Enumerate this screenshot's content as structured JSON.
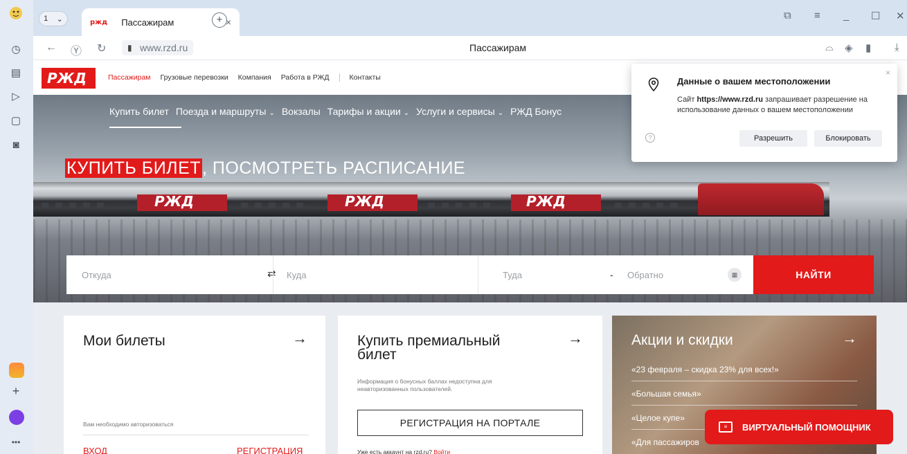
{
  "browser": {
    "tab_count": "1",
    "tab_favicon": "ржд",
    "tab_title": "Пассажирам",
    "tab_close": "×",
    "new_tab": "+",
    "url": "www.rzd.ru",
    "page_title": "Пассажирам"
  },
  "rzd": {
    "logo": "РЖД",
    "top_links": [
      "Пассажирам",
      "Грузовые перевозки",
      "Компания",
      "Работа в РЖД",
      "Контакты"
    ],
    "hero_menu": [
      "Купить билет",
      "Поезда и маршруты",
      "Вокзалы",
      "Тарифы и акции",
      "Услуги и сервисы",
      "РЖД Бонус"
    ],
    "headline_red": "КУПИТЬ БИЛЕТ",
    "headline_rest": ", ПОСМОТРЕТЬ РАСПИСАНИЕ",
    "search": {
      "from_placeholder": "Откуда",
      "to_placeholder": "Куда",
      "there_placeholder": "Туда",
      "back_placeholder": "Обратно",
      "swap": "⇄",
      "dash": "-",
      "find_label": "НАЙТИ"
    },
    "my_tickets": {
      "title": "Мои билеты",
      "need_auth": "Вам необходимо авторизоваться",
      "login": "ВХОД",
      "register": "РЕГИСТРАЦИЯ"
    },
    "premium": {
      "title_line1": "Купить премиальный",
      "title_line2": "билет",
      "info_line1": "Информация о бонусных баллах недоступна для",
      "info_line2": "неавторизованных пользователей.",
      "register_portal": "РЕГИСТРАЦИЯ НА ПОРТАЛЕ",
      "have_account": "Уже есть аккаунт на rzd.ru?",
      "login_link": "Войти"
    },
    "promo": {
      "title": "Акции и скидки",
      "items": [
        "«23 февраля – скидка 23% для всех!»",
        "«Большая семья»",
        "«Целое купе»",
        "«Для пассажиров"
      ]
    },
    "assistant": "ВИРТУАЛЬНЫЙ ПОМОЩНИК"
  },
  "location_popup": {
    "title": "Данные о вашем местоположении",
    "site_prefix": "Сайт",
    "site": "https://www.rzd.ru",
    "body": "запрашивает разрешение на использование данных о вашем местоположении",
    "allow": "Разрешить",
    "block": "Блокировать",
    "close": "×",
    "help": "?"
  },
  "colors": {
    "rzd_red": "#e21a1a"
  }
}
